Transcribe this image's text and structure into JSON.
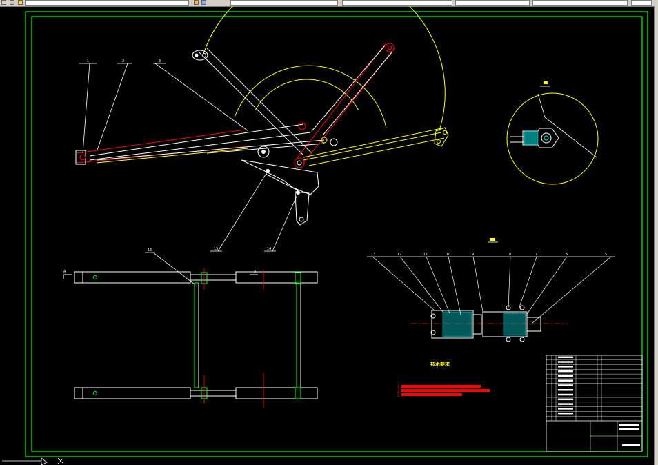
{
  "toolbar": {
    "layer_value": "",
    "style_value": "",
    "lineweight_value": "",
    "plot_style_value": "",
    "icons": [
      "new-icon",
      "open-icon",
      "layer-icon"
    ]
  },
  "colors": {
    "background": "#000000",
    "frame": "#00ff00",
    "geometry": "#ffffff",
    "arc": "#ffff00",
    "highlight": "#ff0000",
    "hatch": "#00ffff",
    "center_line": "#ff0000"
  },
  "drawing": {
    "detail_label": "",
    "section_label": "",
    "tech_requirements_title": "技术要求",
    "tech_requirements_items": [
      "1.",
      "2.",
      "3."
    ],
    "callouts_top": [
      "1",
      "2",
      "3"
    ],
    "callouts_section": [
      "13",
      "12",
      "11",
      "10",
      "9",
      "8",
      "7",
      "6",
      "5"
    ],
    "callouts_mid": [
      "15",
      "14"
    ],
    "callout_bottom": "16",
    "view_marks": [
      "A",
      "A"
    ],
    "drawing_number": ""
  },
  "title_block": {
    "rows": 14
  },
  "ucs_icon": "ucs-icon"
}
